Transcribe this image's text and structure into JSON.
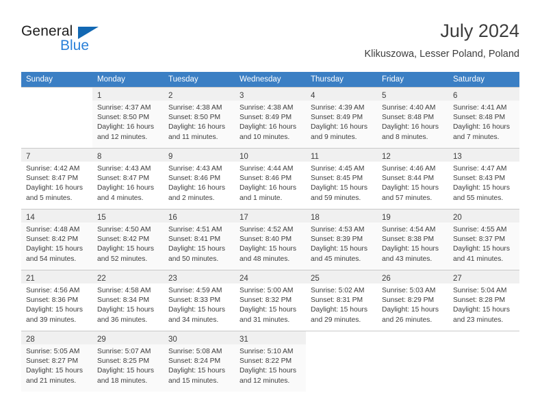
{
  "brand": {
    "name_part1": "General",
    "name_part2": "Blue",
    "triangle_color": "#1268b3",
    "blue_color": "#2980d9"
  },
  "header": {
    "title": "July 2024",
    "location": "Klikuszowa, Lesser Poland, Poland"
  },
  "theme": {
    "header_bg": "#3b7fc4",
    "daynum_bg": "#f0f0f0",
    "row_alt_bg": "#fafafa",
    "grid_line": "#c8c8c8",
    "text": "#3c3c3c"
  },
  "weekdays": [
    "Sunday",
    "Monday",
    "Tuesday",
    "Wednesday",
    "Thursday",
    "Friday",
    "Saturday"
  ],
  "weeks": [
    [
      {
        "day": "",
        "lines": []
      },
      {
        "day": "1",
        "lines": [
          "Sunrise: 4:37 AM",
          "Sunset: 8:50 PM",
          "Daylight: 16 hours",
          "and 12 minutes."
        ]
      },
      {
        "day": "2",
        "lines": [
          "Sunrise: 4:38 AM",
          "Sunset: 8:50 PM",
          "Daylight: 16 hours",
          "and 11 minutes."
        ]
      },
      {
        "day": "3",
        "lines": [
          "Sunrise: 4:38 AM",
          "Sunset: 8:49 PM",
          "Daylight: 16 hours",
          "and 10 minutes."
        ]
      },
      {
        "day": "4",
        "lines": [
          "Sunrise: 4:39 AM",
          "Sunset: 8:49 PM",
          "Daylight: 16 hours",
          "and 9 minutes."
        ]
      },
      {
        "day": "5",
        "lines": [
          "Sunrise: 4:40 AM",
          "Sunset: 8:48 PM",
          "Daylight: 16 hours",
          "and 8 minutes."
        ]
      },
      {
        "day": "6",
        "lines": [
          "Sunrise: 4:41 AM",
          "Sunset: 8:48 PM",
          "Daylight: 16 hours",
          "and 7 minutes."
        ]
      }
    ],
    [
      {
        "day": "7",
        "lines": [
          "Sunrise: 4:42 AM",
          "Sunset: 8:47 PM",
          "Daylight: 16 hours",
          "and 5 minutes."
        ]
      },
      {
        "day": "8",
        "lines": [
          "Sunrise: 4:43 AM",
          "Sunset: 8:47 PM",
          "Daylight: 16 hours",
          "and 4 minutes."
        ]
      },
      {
        "day": "9",
        "lines": [
          "Sunrise: 4:43 AM",
          "Sunset: 8:46 PM",
          "Daylight: 16 hours",
          "and 2 minutes."
        ]
      },
      {
        "day": "10",
        "lines": [
          "Sunrise: 4:44 AM",
          "Sunset: 8:46 PM",
          "Daylight: 16 hours",
          "and 1 minute."
        ]
      },
      {
        "day": "11",
        "lines": [
          "Sunrise: 4:45 AM",
          "Sunset: 8:45 PM",
          "Daylight: 15 hours",
          "and 59 minutes."
        ]
      },
      {
        "day": "12",
        "lines": [
          "Sunrise: 4:46 AM",
          "Sunset: 8:44 PM",
          "Daylight: 15 hours",
          "and 57 minutes."
        ]
      },
      {
        "day": "13",
        "lines": [
          "Sunrise: 4:47 AM",
          "Sunset: 8:43 PM",
          "Daylight: 15 hours",
          "and 55 minutes."
        ]
      }
    ],
    [
      {
        "day": "14",
        "lines": [
          "Sunrise: 4:48 AM",
          "Sunset: 8:42 PM",
          "Daylight: 15 hours",
          "and 54 minutes."
        ]
      },
      {
        "day": "15",
        "lines": [
          "Sunrise: 4:50 AM",
          "Sunset: 8:42 PM",
          "Daylight: 15 hours",
          "and 52 minutes."
        ]
      },
      {
        "day": "16",
        "lines": [
          "Sunrise: 4:51 AM",
          "Sunset: 8:41 PM",
          "Daylight: 15 hours",
          "and 50 minutes."
        ]
      },
      {
        "day": "17",
        "lines": [
          "Sunrise: 4:52 AM",
          "Sunset: 8:40 PM",
          "Daylight: 15 hours",
          "and 48 minutes."
        ]
      },
      {
        "day": "18",
        "lines": [
          "Sunrise: 4:53 AM",
          "Sunset: 8:39 PM",
          "Daylight: 15 hours",
          "and 45 minutes."
        ]
      },
      {
        "day": "19",
        "lines": [
          "Sunrise: 4:54 AM",
          "Sunset: 8:38 PM",
          "Daylight: 15 hours",
          "and 43 minutes."
        ]
      },
      {
        "day": "20",
        "lines": [
          "Sunrise: 4:55 AM",
          "Sunset: 8:37 PM",
          "Daylight: 15 hours",
          "and 41 minutes."
        ]
      }
    ],
    [
      {
        "day": "21",
        "lines": [
          "Sunrise: 4:56 AM",
          "Sunset: 8:36 PM",
          "Daylight: 15 hours",
          "and 39 minutes."
        ]
      },
      {
        "day": "22",
        "lines": [
          "Sunrise: 4:58 AM",
          "Sunset: 8:34 PM",
          "Daylight: 15 hours",
          "and 36 minutes."
        ]
      },
      {
        "day": "23",
        "lines": [
          "Sunrise: 4:59 AM",
          "Sunset: 8:33 PM",
          "Daylight: 15 hours",
          "and 34 minutes."
        ]
      },
      {
        "day": "24",
        "lines": [
          "Sunrise: 5:00 AM",
          "Sunset: 8:32 PM",
          "Daylight: 15 hours",
          "and 31 minutes."
        ]
      },
      {
        "day": "25",
        "lines": [
          "Sunrise: 5:02 AM",
          "Sunset: 8:31 PM",
          "Daylight: 15 hours",
          "and 29 minutes."
        ]
      },
      {
        "day": "26",
        "lines": [
          "Sunrise: 5:03 AM",
          "Sunset: 8:29 PM",
          "Daylight: 15 hours",
          "and 26 minutes."
        ]
      },
      {
        "day": "27",
        "lines": [
          "Sunrise: 5:04 AM",
          "Sunset: 8:28 PM",
          "Daylight: 15 hours",
          "and 23 minutes."
        ]
      }
    ],
    [
      {
        "day": "28",
        "lines": [
          "Sunrise: 5:05 AM",
          "Sunset: 8:27 PM",
          "Daylight: 15 hours",
          "and 21 minutes."
        ]
      },
      {
        "day": "29",
        "lines": [
          "Sunrise: 5:07 AM",
          "Sunset: 8:25 PM",
          "Daylight: 15 hours",
          "and 18 minutes."
        ]
      },
      {
        "day": "30",
        "lines": [
          "Sunrise: 5:08 AM",
          "Sunset: 8:24 PM",
          "Daylight: 15 hours",
          "and 15 minutes."
        ]
      },
      {
        "day": "31",
        "lines": [
          "Sunrise: 5:10 AM",
          "Sunset: 8:22 PM",
          "Daylight: 15 hours",
          "and 12 minutes."
        ]
      },
      {
        "day": "",
        "lines": []
      },
      {
        "day": "",
        "lines": []
      },
      {
        "day": "",
        "lines": []
      }
    ]
  ]
}
